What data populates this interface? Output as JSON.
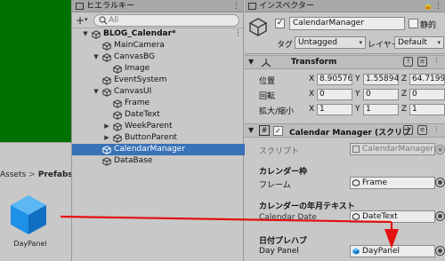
{
  "project": {
    "breadcrumb": [
      "Assets",
      "Prefabs"
    ],
    "asset_label": "DayPanel"
  },
  "hierarchy": {
    "tab_label": "ヒエラルキー",
    "search_placeholder": "All",
    "items": [
      {
        "label": "BLOG_Calendar*",
        "depth": 0,
        "arrow": "down",
        "icon": "unity",
        "selected": false
      },
      {
        "label": "MainCamera",
        "depth": 1,
        "arrow": "",
        "icon": "cube",
        "selected": false
      },
      {
        "label": "CanvasBG",
        "depth": 1,
        "arrow": "down",
        "icon": "cube",
        "selected": false
      },
      {
        "label": "Image",
        "depth": 2,
        "arrow": "",
        "icon": "cube",
        "selected": false
      },
      {
        "label": "EventSystem",
        "depth": 1,
        "arrow": "",
        "icon": "cube",
        "selected": false
      },
      {
        "label": "CanvasUI",
        "depth": 1,
        "arrow": "down",
        "icon": "cube",
        "selected": false
      },
      {
        "label": "Frame",
        "depth": 2,
        "arrow": "",
        "icon": "cube",
        "selected": false
      },
      {
        "label": "DateText",
        "depth": 2,
        "arrow": "",
        "icon": "cube",
        "selected": false
      },
      {
        "label": "WeekParent",
        "depth": 2,
        "arrow": "right",
        "icon": "cube",
        "selected": false
      },
      {
        "label": "ButtonParent",
        "depth": 2,
        "arrow": "right",
        "icon": "cube",
        "selected": false
      },
      {
        "label": "CalendarManager",
        "depth": 1,
        "arrow": "",
        "icon": "cube",
        "selected": true
      },
      {
        "label": "DataBase",
        "depth": 1,
        "arrow": "",
        "icon": "cube",
        "selected": false
      }
    ]
  },
  "inspector": {
    "tab_label": "インスペクター",
    "object_name": "CalendarManager",
    "static_label": "静的",
    "tag_label": "タグ",
    "tag_value": "Untagged",
    "layer_label": "レイヤー",
    "layer_value": "Default",
    "transform": {
      "title": "Transform",
      "rows": [
        {
          "label": "位置",
          "x": "8.90576",
          "y": "1.55894",
          "z": "64.7199"
        },
        {
          "label": "回転",
          "x": "0",
          "y": "0",
          "z": "0"
        },
        {
          "label": "拡大/縮小",
          "x": "1",
          "y": "1",
          "z": "1"
        }
      ],
      "axes": [
        "X",
        "Y",
        "Z"
      ]
    },
    "script_component": {
      "title": "Calendar Manager (スクリプ",
      "script_label": "スクリプト",
      "script_value": "CalendarManager",
      "sections": [
        {
          "header": "カレンダー枠",
          "field_label": "フレーム",
          "value": "Frame"
        },
        {
          "header": "カレンダーの年月テキスト",
          "field_label": "Calendar Date",
          "value": "DateText"
        },
        {
          "header": "日付プレハブ",
          "field_label": "Day Panel",
          "value": "DayPanel"
        }
      ]
    }
  },
  "colors": {
    "scene_green": "#007000",
    "selection_blue": "#3a72b8",
    "annotation_red": "#e31010",
    "prefab_blue": "#1e90e6"
  }
}
